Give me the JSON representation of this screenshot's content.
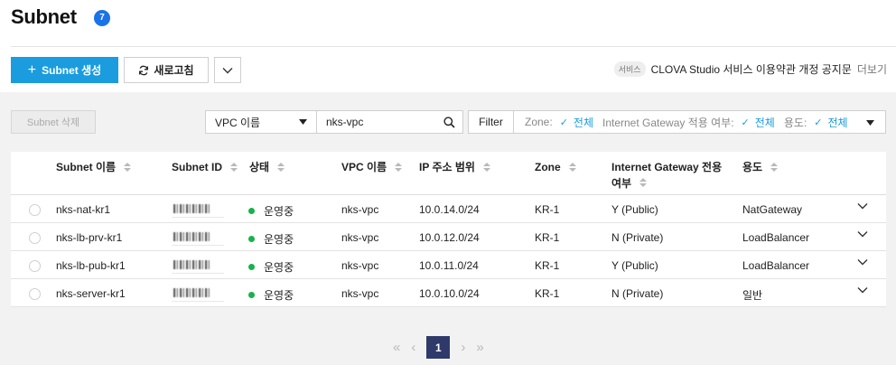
{
  "header": {
    "title": "Subnet",
    "count": "7"
  },
  "toolbar": {
    "create_label": "Subnet 생성",
    "refresh_label": "새로고침",
    "notice_tag": "서비스",
    "notice_text": "CLOVA Studio 서비스 이용약관 개정 공지문",
    "notice_more": "더보기"
  },
  "controls": {
    "delete_label": "Subnet 삭제",
    "vpc_select": "VPC 이름",
    "search_value": "nks-vpc",
    "filter_label": "Filter",
    "filters": [
      {
        "label": "Zone:",
        "value": "전체"
      },
      {
        "label": "Internet Gateway 적용 여부:",
        "value": "전체"
      },
      {
        "label": "용도:",
        "value": "전체"
      }
    ]
  },
  "table": {
    "columns": [
      "Subnet 이름",
      "Subnet ID",
      "상태",
      "VPC 이름",
      "IP 주소 범위",
      "Zone",
      "Internet Gateway 전용 여부",
      "용도"
    ],
    "rows": [
      {
        "name": "nks-nat-kr1",
        "status": "운영중",
        "vpc": "nks-vpc",
        "ip": "10.0.14.0/24",
        "zone": "KR-1",
        "igw": "Y (Public)",
        "usage": "NatGateway"
      },
      {
        "name": "nks-lb-prv-kr1",
        "status": "운영중",
        "vpc": "nks-vpc",
        "ip": "10.0.12.0/24",
        "zone": "KR-1",
        "igw": "N (Private)",
        "usage": "LoadBalancer"
      },
      {
        "name": "nks-lb-pub-kr1",
        "status": "운영중",
        "vpc": "nks-vpc",
        "ip": "10.0.11.0/24",
        "zone": "KR-1",
        "igw": "Y (Public)",
        "usage": "LoadBalancer"
      },
      {
        "name": "nks-server-kr1",
        "status": "운영중",
        "vpc": "nks-vpc",
        "ip": "10.0.10.0/24",
        "zone": "KR-1",
        "igw": "N (Private)",
        "usage": "일반"
      }
    ]
  },
  "pagination": {
    "current": "1",
    "first": "«",
    "prev": "‹",
    "next": "›",
    "last": "»"
  },
  "colors": {
    "primary": "#1a9cdf",
    "badge": "#1a73e8",
    "running": "#16b34a",
    "page_active": "#2f3a6b"
  }
}
